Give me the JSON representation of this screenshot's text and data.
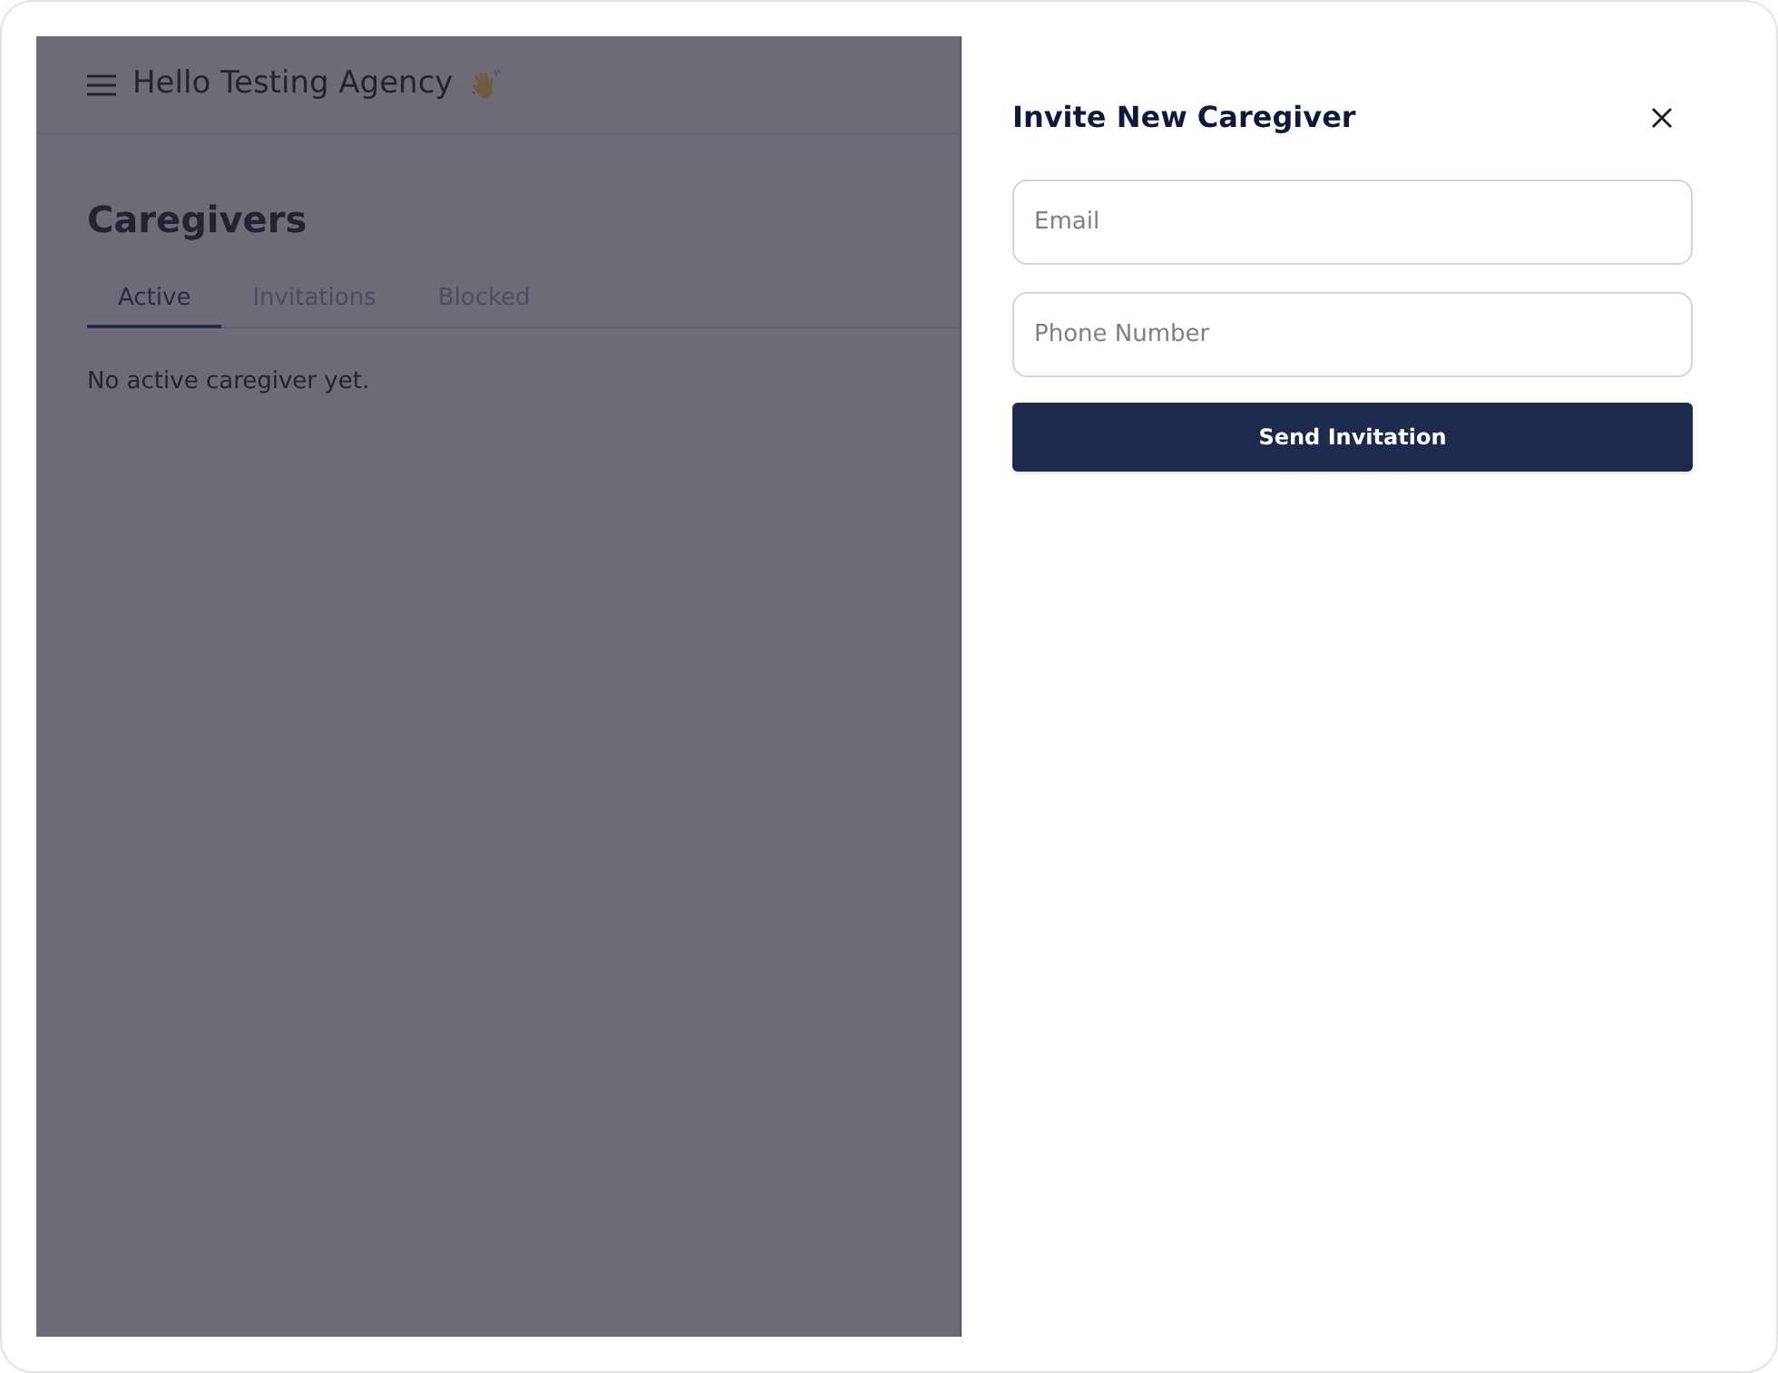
{
  "header": {
    "title": "Hello Testing Agency"
  },
  "page": {
    "title": "Caregivers",
    "tabs": [
      {
        "label": "Active",
        "selected": true
      },
      {
        "label": "Invitations",
        "selected": false
      },
      {
        "label": "Blocked",
        "selected": false
      }
    ],
    "empty_message": "No active caregiver yet."
  },
  "drawer": {
    "title": "Invite New Caregiver",
    "fields": [
      {
        "placeholder": "Email"
      },
      {
        "placeholder": "Phone Number"
      }
    ],
    "submit_button": "Send Invitation"
  }
}
